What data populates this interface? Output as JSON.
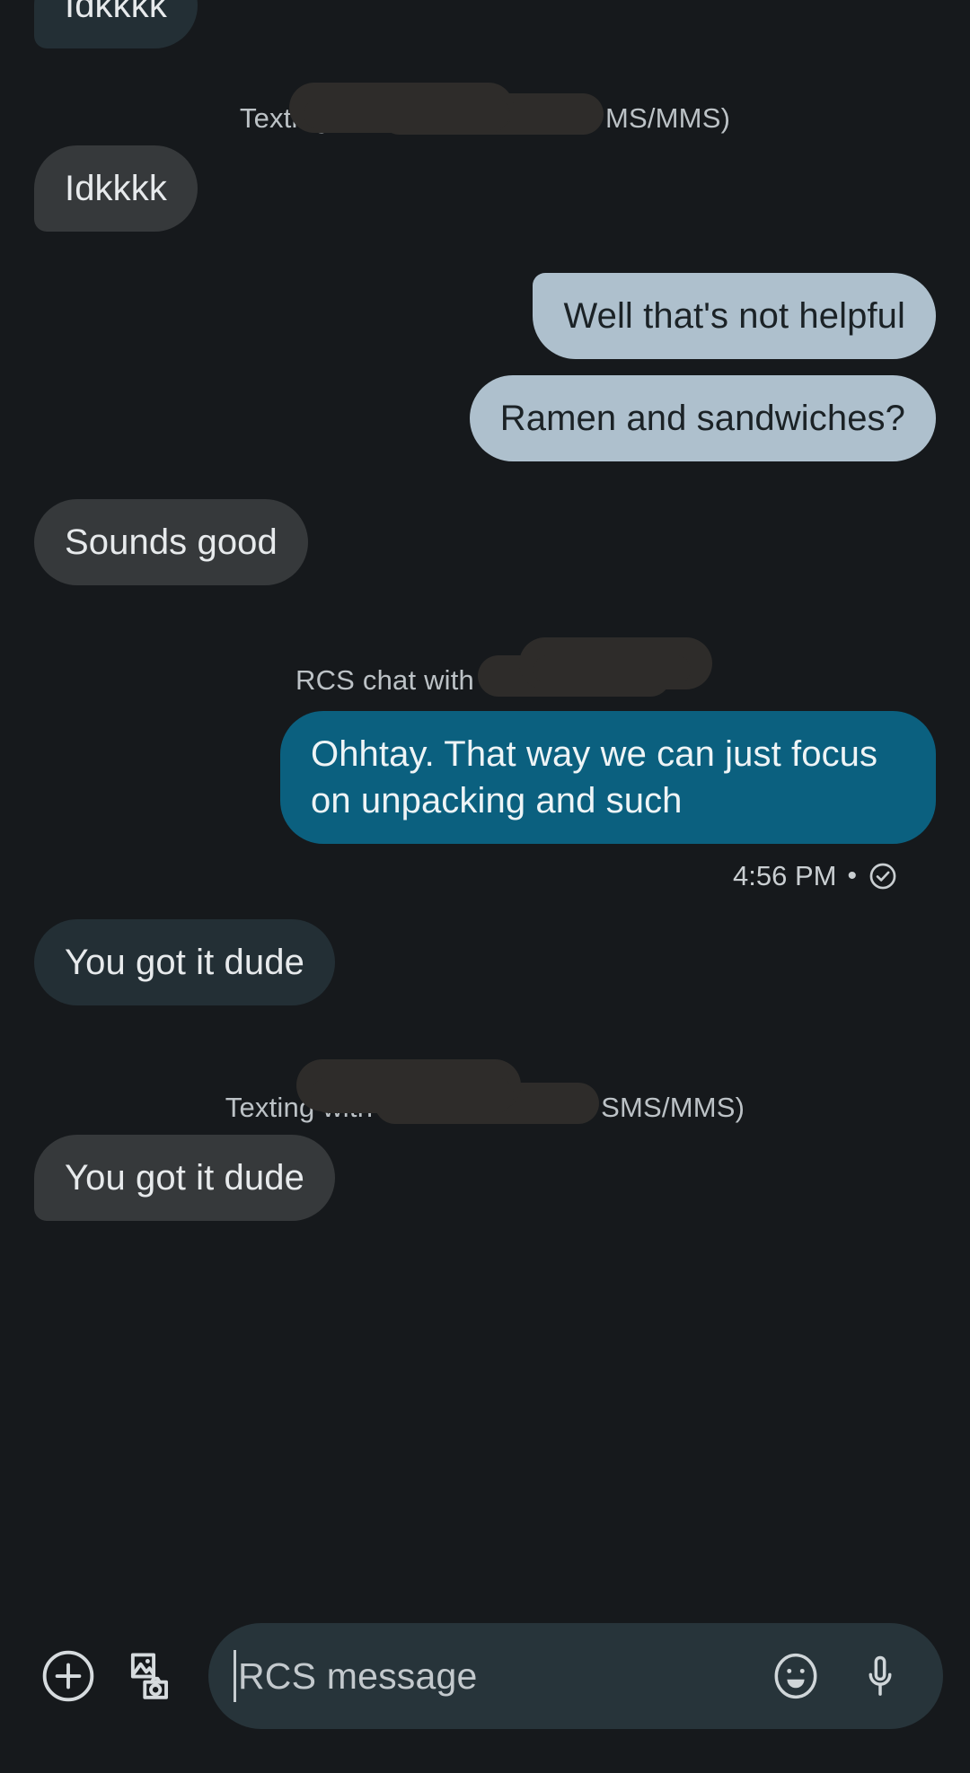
{
  "app": {
    "background_color": "#16191c",
    "accent_teal": "#0b607f",
    "outgoing_bubble_color": "#aec0cd",
    "rcs_incoming_color": "#232f35",
    "sms_incoming_color": "#36393b"
  },
  "thread": {
    "messages": [
      {
        "id": "m1",
        "side": "left",
        "style": "rcs-in",
        "text": "Idkkkk"
      },
      {
        "id": "m2",
        "side": "left",
        "style": "sms-in",
        "text": "Idkkkk"
      },
      {
        "id": "m3",
        "side": "right",
        "style": "out",
        "text": "Well that's not helpful"
      },
      {
        "id": "m4",
        "side": "right",
        "style": "out",
        "text": "Ramen and sandwiches?"
      },
      {
        "id": "m5",
        "side": "left",
        "style": "sms-in",
        "text": "Sounds good"
      },
      {
        "id": "m6",
        "side": "right",
        "style": "rcs-out",
        "text": "Ohhtay. That way we can just focus on unpacking and such"
      },
      {
        "id": "m7",
        "side": "left",
        "style": "rcs-in",
        "text": "You got it dude"
      },
      {
        "id": "m8",
        "side": "left",
        "style": "sms-in",
        "text": "You got it dude"
      }
    ],
    "labels": {
      "texting_with_prefix": "Texting wit'",
      "texting_with_suffix": "MS/MMS)",
      "texting_with_prefix_2": "Texting with",
      "texting_with_suffix_2": "SMS/MMS)",
      "rcs_chat_with": "RCS chat with"
    },
    "status": {
      "timestamp": "4:56 PM",
      "separator": "•",
      "delivery_icon": "check-circle-icon"
    }
  },
  "composer": {
    "add_icon": "plus-circle-icon",
    "gallery_icon": "gallery-camera-icon",
    "placeholder": "RCS message",
    "value": "",
    "emoji_icon": "emoji-smiley-icon",
    "mic_icon": "microphone-icon"
  }
}
